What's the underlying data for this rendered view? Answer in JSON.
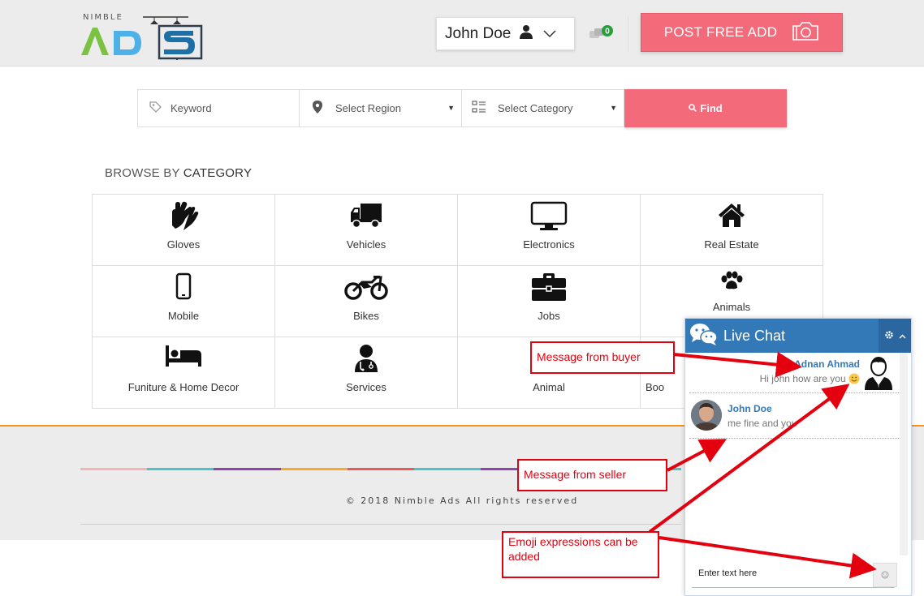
{
  "header": {
    "logo_small": "NIMBLE",
    "user_name": "John Doe",
    "message_count": "0",
    "post_button_label": "POST FREE ADD"
  },
  "search": {
    "keyword_placeholder": "Keyword",
    "region_label": "Select Region",
    "category_label": "Select Category",
    "find_label": "Find"
  },
  "browse": {
    "prefix": "BROWSE BY ",
    "emphasis": "CATEGORY"
  },
  "categories": [
    {
      "label": "Gloves",
      "icon": "hands-icon"
    },
    {
      "label": "Vehicles",
      "icon": "truck-icon"
    },
    {
      "label": "Electronics",
      "icon": "monitor-icon"
    },
    {
      "label": "Real Estate",
      "icon": "home-icon"
    },
    {
      "label": "Mobile",
      "icon": "mobile-phone-icon"
    },
    {
      "label": "Bikes",
      "icon": "motorcycle-icon"
    },
    {
      "label": "Jobs",
      "icon": "briefcase-icon"
    },
    {
      "label": "Animals",
      "icon": "paw-icon"
    },
    {
      "label": "Funiture & Home Decor",
      "icon": "bed-icon"
    },
    {
      "label": "Services",
      "icon": "doctor-icon"
    },
    {
      "label": "Animal",
      "icon": ""
    },
    {
      "label": "Boo",
      "icon": ""
    }
  ],
  "footer": {
    "copyright": "© 2018 Nimble Ads All rights reserved",
    "rainbow_colors": [
      "#f5b3b3",
      "#4ec1c9",
      "#8e44ad",
      "#f7a928",
      "#e85a5a",
      "#4ec1c9",
      "#8e44ad",
      "#f7a928",
      "#4ec1c9"
    ]
  },
  "chat": {
    "title": "Live Chat",
    "messages": [
      {
        "from": "Adnan Ahmad",
        "text": "Hi john how are you"
      },
      {
        "from": "John Doe",
        "text": "me fine and you"
      }
    ],
    "input_placeholder": "Enter text here"
  },
  "callouts": {
    "buyer": "Message from buyer",
    "seller": "Message from seller",
    "emoji": "Emoji expressions can be added"
  },
  "colors": {
    "accent": "#f36a7b",
    "chat_blue": "#3479b7",
    "footer_orange": "#f7941d",
    "callout_red": "#e3000f"
  }
}
